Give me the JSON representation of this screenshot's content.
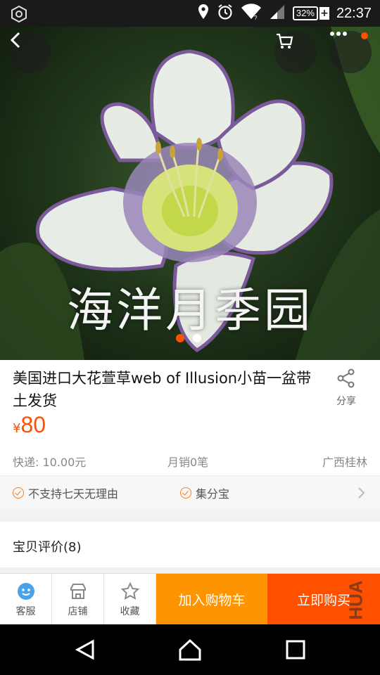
{
  "status_bar": {
    "time": "22:37",
    "battery": "32%",
    "icons": [
      "settings-ring-icon",
      "location-icon",
      "alarm-icon",
      "wifi-icon",
      "signal-icon",
      "battery-icon"
    ]
  },
  "hero": {
    "watermark_text": "海洋月季园",
    "carousel": {
      "count": 2,
      "active_index": 0
    }
  },
  "product": {
    "title": "美国进口大花萱草web of Illusion小苗一盆带土发货",
    "share_label": "分享",
    "price_symbol": "¥",
    "price": "80",
    "shipping": "快递: 10.00元",
    "monthly_sales": "月销0笔",
    "location": "广西桂林"
  },
  "services": {
    "items": [
      "不支持七天无理由",
      "集分宝"
    ]
  },
  "reviews": {
    "label": "宝贝评价(8)"
  },
  "action_bar": {
    "customer_service": "客服",
    "shop": "店铺",
    "favorite": "收藏",
    "add_to_cart": "加入购物车",
    "buy_now": "立即购买",
    "corner_watermark": "HUA"
  },
  "colors": {
    "accent": "#ff5000",
    "cart": "#ff9402"
  }
}
